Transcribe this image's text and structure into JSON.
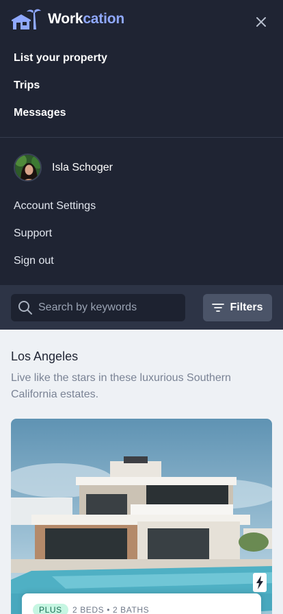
{
  "brand": {
    "name_part1": "Work",
    "name_part2": "cation",
    "accent_color": "#8fa8ff"
  },
  "header": {
    "close_icon": "close-icon"
  },
  "nav": {
    "items": [
      {
        "label": "List your property"
      },
      {
        "label": "Trips"
      },
      {
        "label": "Messages"
      }
    ]
  },
  "user": {
    "name": "Isla Schoger"
  },
  "account": {
    "items": [
      {
        "label": "Account Settings"
      },
      {
        "label": "Support"
      },
      {
        "label": "Sign out"
      }
    ]
  },
  "search": {
    "placeholder": "Search by keywords",
    "value": "",
    "filters_label": "Filters"
  },
  "section": {
    "title": "Los Angeles",
    "description": "Live like the stars in these luxurious Southern California estates."
  },
  "listing": {
    "badge": "PLUS",
    "details": "2 BEDS • 2 BATHS",
    "badge_bg": "#c6f6e2",
    "badge_color": "#1b6e54"
  }
}
